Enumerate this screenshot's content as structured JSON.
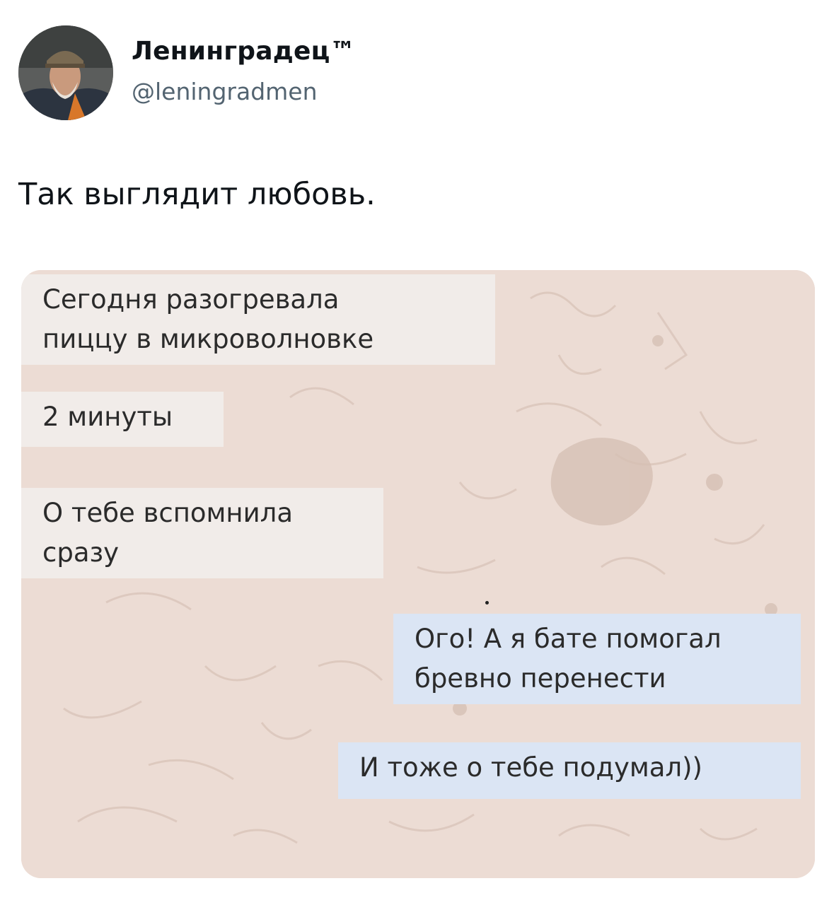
{
  "author": {
    "display_name": "Ленинградец™",
    "handle": "@leningradmen"
  },
  "tweet": {
    "text": "Так выглядит любовь."
  },
  "media": {
    "messages": [
      {
        "side": "incoming",
        "text": "Сегодня разогревала\nпиццу в микроволновке"
      },
      {
        "side": "incoming",
        "text": "2 минуты"
      },
      {
        "side": "incoming",
        "text": "О тебе вспомнила\nсразу"
      },
      {
        "side": "outgoing",
        "text": "Ого! А я бате помогал\nбревно перенести"
      },
      {
        "side": "outgoing",
        "text": "И тоже о тебе подумал))"
      }
    ]
  }
}
